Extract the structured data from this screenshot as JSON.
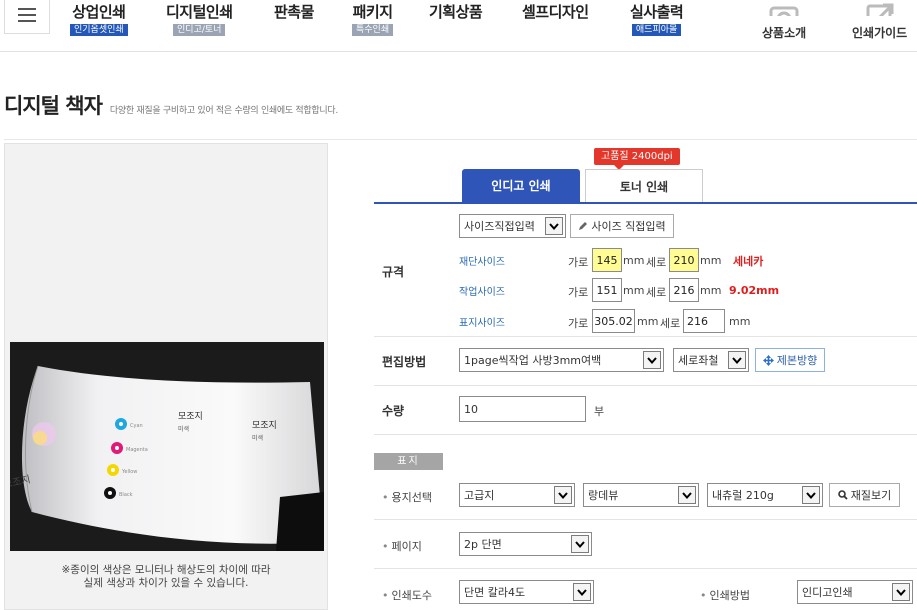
{
  "nav": {
    "items": [
      {
        "label": "상업인쇄",
        "badge": "인기옵셋인쇄",
        "badge_color": "#2458b8"
      },
      {
        "label": "디지털인쇄",
        "badge": "인디고/토너",
        "badge_color": "#9aa4b4"
      },
      {
        "label": "판촉물",
        "badge": ""
      },
      {
        "label": "패키지",
        "badge": "특수인쇄",
        "badge_color": "#9aa4b4"
      },
      {
        "label": "기획상품",
        "badge": ""
      },
      {
        "label": "셀프디자인",
        "badge": ""
      },
      {
        "label": "실사출력",
        "badge": "애드피아몰",
        "badge_color": "#2458b8"
      }
    ],
    "side_links": [
      {
        "label": "상품소개",
        "icon": "camera-icon"
      },
      {
        "label": "인쇄가이드",
        "icon": "external-link-icon"
      }
    ]
  },
  "page": {
    "title": "디지털 책자",
    "subtitle": "다양한 재질을 구비하고 있어 적은 수량의 인쇄에도 적합합니다."
  },
  "product": {
    "notice_line1": "※종이의 색상은 모니터나 해상도의 차이에 따라",
    "notice_line2": "실제 색상과 차이가 있을 수 있습니다."
  },
  "tabs": {
    "hq_tag": "고품질 2400dpi",
    "active": "인디고 인쇄",
    "inactive": "토너 인쇄"
  },
  "spec": {
    "label": "규격",
    "size_select": "사이즈직접입력",
    "size_button": "사이즈 직접입력",
    "cut_label": "재단사이즈",
    "work_label": "작업사이즈",
    "cover_label": "표지사이즈",
    "width_word": "가로",
    "height_word": "세로",
    "unit": "mm",
    "cut_w": "145",
    "cut_h": "210",
    "work_w": "151",
    "work_h": "216",
    "cover_w": "305.02",
    "cover_h": "216",
    "cut_note": "세네카",
    "work_note": "9.02mm"
  },
  "edit": {
    "label": "편집방법",
    "method": "1page씩작업 사방3mm여백",
    "binding": "세로좌철",
    "direction_button": "제본방향"
  },
  "quantity": {
    "label": "수량",
    "value": "10",
    "unit": "부"
  },
  "cover": {
    "section": "표지",
    "paper_label": "용지선택",
    "paper_grade": "고급지",
    "paper_type": "랑데뷰",
    "paper_weight": "내츄럴 210g",
    "paper_button": "재질보기",
    "pages_label": "페이지",
    "pages_value": "2p 단면",
    "color_label": "인쇄도수",
    "color_value": "단면 칼라4도",
    "method_label": "인쇄방법",
    "method_value": "인디고인쇄"
  },
  "photo_card": {
    "header": "모조지",
    "sub": "미색",
    "swatches": [
      {
        "name": "cyan",
        "color": "#1ea7e1",
        "text": "Cyan"
      },
      {
        "name": "magenta",
        "color": "#e0197d",
        "text": "Magenta"
      },
      {
        "name": "yellow",
        "color": "#f3d800",
        "text": "Yellow"
      },
      {
        "name": "black",
        "color": "#111111",
        "text": "Black"
      }
    ]
  }
}
